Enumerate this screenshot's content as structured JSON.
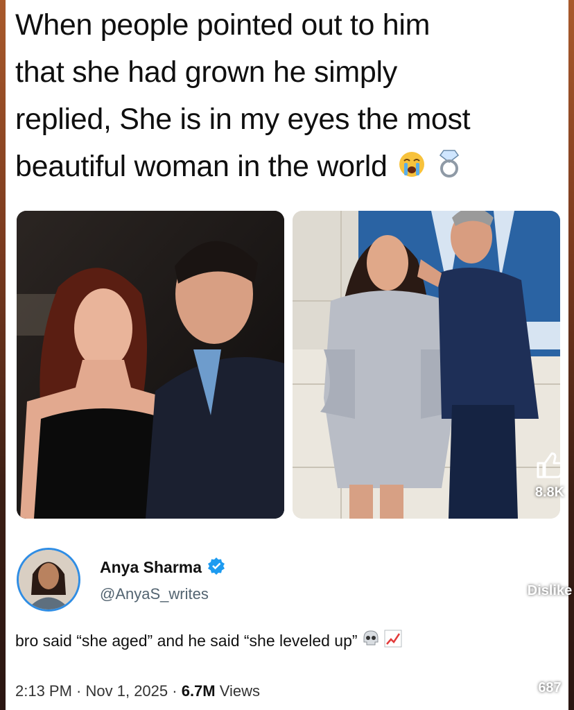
{
  "post": {
    "headline_lines": [
      "When people pointed out to him",
      "that she had grown he simply",
      "replied, She is in my eyes the most",
      "beautiful woman in the world"
    ],
    "headline_emojis": [
      "crying-face-icon",
      "ring-icon"
    ]
  },
  "reply": {
    "name": "Anya Sharma",
    "verified_icon": "verified-badge-icon",
    "handle": "@AnyaS_writes",
    "text": "bro said “she aged” and he said “she leveled up”",
    "text_emojis": [
      "skull-icon",
      "chart-increasing-icon"
    ]
  },
  "meta": {
    "time": "2:13 PM",
    "sep1": " · ",
    "date": "Nov 1, 2025",
    "sep2": " · ",
    "views_count": "6.7M",
    "views_label": " Views"
  },
  "side_actions": {
    "like_count": "8.8K",
    "dislike_label": "Dislike",
    "comment_count": "687"
  },
  "colors": {
    "verified_blue": "#1d9bf0",
    "avatar_ring": "#2f8de4",
    "handle_gray": "#536471"
  }
}
